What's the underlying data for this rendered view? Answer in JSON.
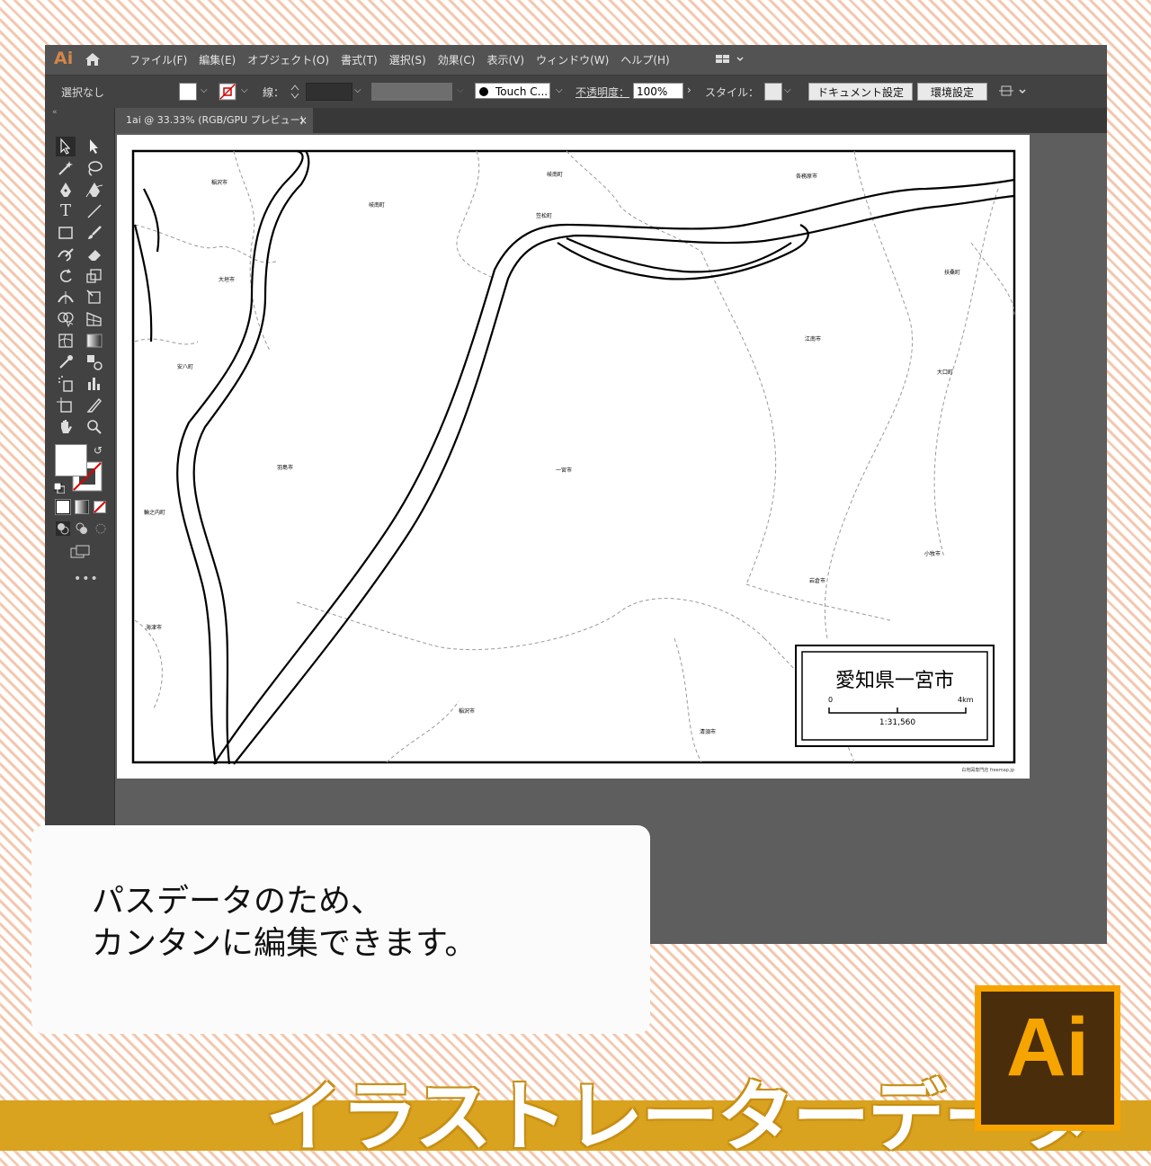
{
  "menubar": {
    "logo": "Ai",
    "items": [
      "ファイル(F)",
      "編集(E)",
      "オブジェクト(O)",
      "書式(T)",
      "選択(S)",
      "効果(C)",
      "表示(V)",
      "ウィンドウ(W)",
      "ヘルプ(H)"
    ]
  },
  "optionsbar": {
    "selection": "選択なし",
    "stroke_label": "線：",
    "brush_label": "Touch C...",
    "opacity_label": "不透明度：",
    "opacity_value": "100%",
    "style_label": "スタイル：",
    "doc_settings_button": "ドキュメント設定",
    "preferences_button": "環境設定"
  },
  "document_tab": {
    "title": "1ai @ 33.33% (RGB/GPU プレビュー)",
    "close": "×"
  },
  "map": {
    "place_labels": [
      "稲沢市",
      "稲沢市",
      "岐南町",
      "笠松町",
      "各務原市",
      "羽島市",
      "大垣市",
      "安八町",
      "江南市",
      "大口町",
      "扶桑町",
      "一宮市",
      "羽島市",
      "輪之内町",
      "海津市",
      "稲沢市",
      "小牧市",
      "岩倉市",
      "清須市"
    ],
    "title": "愛知県一宮市",
    "scale_start": "0",
    "scale_end": "4km",
    "scale_ratio": "1:31,560",
    "credit": "白地図専門店 freemap.jp"
  },
  "promo": {
    "line1": "パスデータのため、",
    "line2": "カンタンに編集できます。",
    "banner": "イラストレーターデータ",
    "badge": "Ai"
  },
  "colors": {
    "app_bg": "#535353",
    "panel_bg": "#424242",
    "canvas_bg": "#5e5e5e",
    "banner": "#d9a21f",
    "badge_outer": "#f6a400",
    "badge_inner": "#4a2d0a"
  },
  "icons": [
    "home-icon",
    "workspace-icon",
    "selection-tool-icon",
    "direct-selection-tool-icon",
    "magic-wand-icon",
    "lasso-icon",
    "pen-icon",
    "curvature-icon",
    "type-icon",
    "line-icon",
    "rectangle-icon",
    "paintbrush-icon",
    "shaper-icon",
    "eraser-icon",
    "rotate-icon",
    "scale-icon",
    "width-icon",
    "free-transform-icon",
    "shape-builder-icon",
    "perspective-grid-icon",
    "mesh-icon",
    "gradient-icon",
    "eyedropper-icon",
    "blend-icon",
    "symbol-sprayer-icon",
    "graph-icon",
    "artboard-icon",
    "slice-icon",
    "hand-icon",
    "zoom-icon"
  ]
}
